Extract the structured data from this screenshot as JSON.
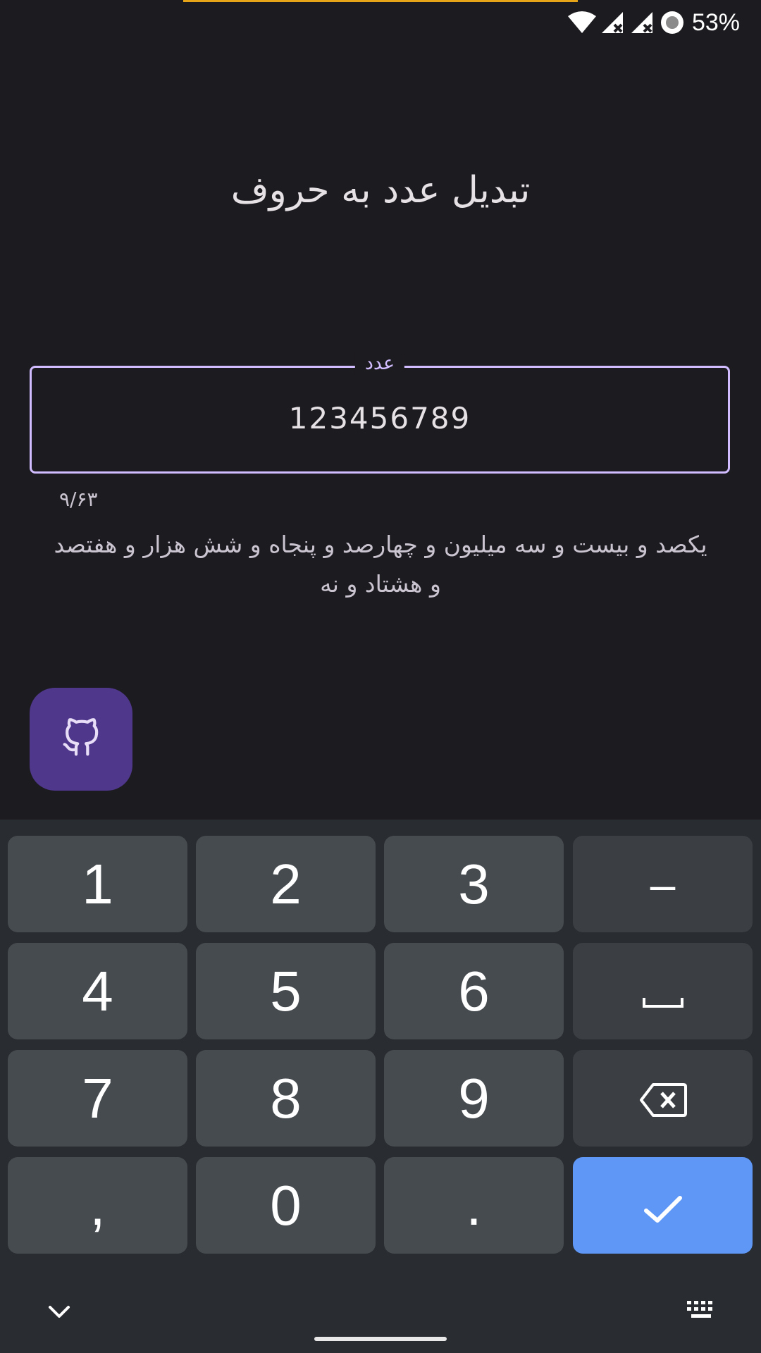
{
  "status_bar": {
    "battery_percent": "53%",
    "icons": [
      "wifi-icon",
      "signal-no-data-icon",
      "signal-no-data-icon",
      "battery-saver-icon"
    ],
    "accent_color": "#e6a519"
  },
  "app": {
    "title": "تبدیل عدد به حروف",
    "input": {
      "label": "عدد",
      "value": "123456789",
      "counter": "۹/۶۳"
    },
    "result_text": "یکصد و بیست و سه میلیون  و چهارصد و پنجاه و شش هزار  و هفتصد و هشتاد و نه",
    "fab_icon": "github-icon",
    "accent_color": "#d0bcff",
    "fab_color": "#4f378b"
  },
  "keyboard": {
    "row1": [
      "1",
      "2",
      "3",
      "–"
    ],
    "row2": [
      "4",
      "5",
      "6"
    ],
    "row3": [
      "7",
      "8",
      "9"
    ],
    "row4": [
      ",",
      "0",
      "."
    ],
    "special_icons": [
      "space-icon",
      "backspace-icon",
      "checkmark-icon",
      "hide-keyboard-icon",
      "keyboard-switch-icon"
    ],
    "enter_color": "#5e97f6"
  }
}
